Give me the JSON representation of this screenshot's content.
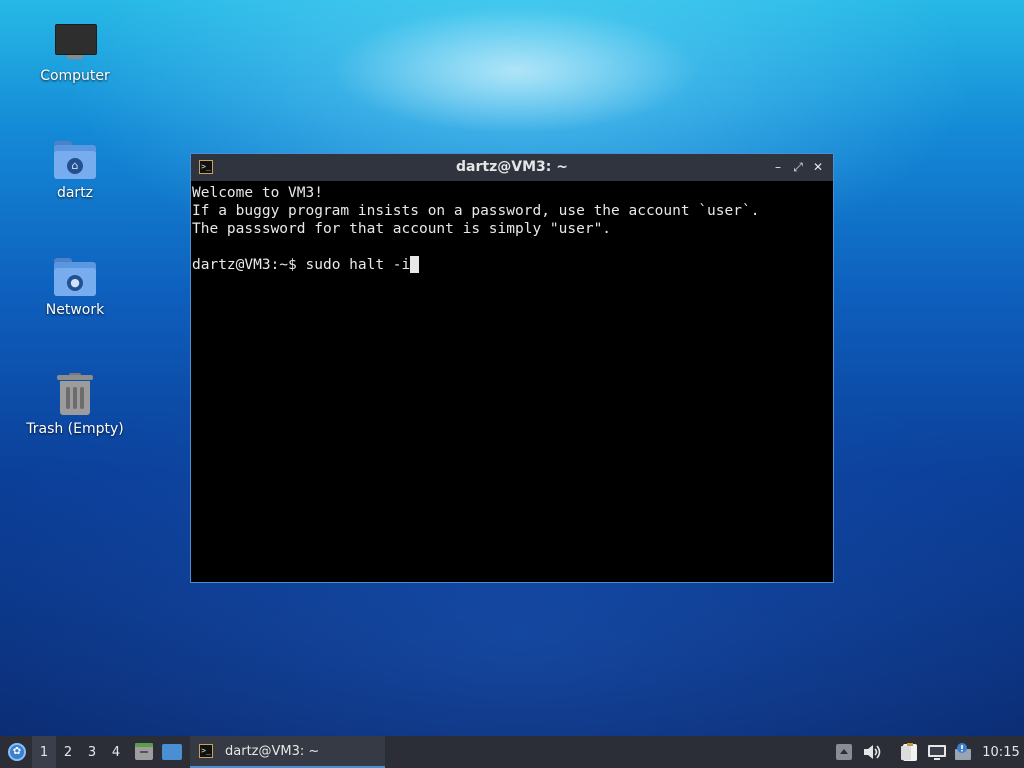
{
  "desktop": {
    "icons": [
      {
        "label": "Computer",
        "icon": "computer-icon"
      },
      {
        "label": "dartz",
        "icon": "home-folder-icon"
      },
      {
        "label": "Network",
        "icon": "network-folder-icon"
      },
      {
        "label": "Trash (Empty)",
        "icon": "trash-icon"
      }
    ]
  },
  "terminal": {
    "title": "dartz@VM3: ~",
    "controls": {
      "minimize": "–",
      "maximize": "⤢",
      "close": "✕"
    },
    "lines": [
      "Welcome to VM3!",
      "If a buggy program insists on a password, use the account `user`.",
      "The passsword for that account is simply \"user\".",
      ""
    ],
    "prompt": "dartz@VM3:~$ ",
    "input": "sudo halt -i"
  },
  "taskbar": {
    "workspaces": [
      "1",
      "2",
      "3",
      "4"
    ],
    "active_workspace": "1",
    "tasks": [
      {
        "label": "dartz@VM3: ~",
        "icon": "terminal-icon"
      }
    ],
    "tray_icons": [
      "tray-arrow-icon",
      "volume-icon",
      "clipboard-icon",
      "network-monitor-icon",
      "update-notifier-icon"
    ],
    "clock": "10:15"
  },
  "colors": {
    "accent": "#4a8fd4",
    "panel": "#2b2e37",
    "titlebar": "#2f343f",
    "terminal_bg": "#000000",
    "terminal_fg": "#e8e8e8"
  }
}
